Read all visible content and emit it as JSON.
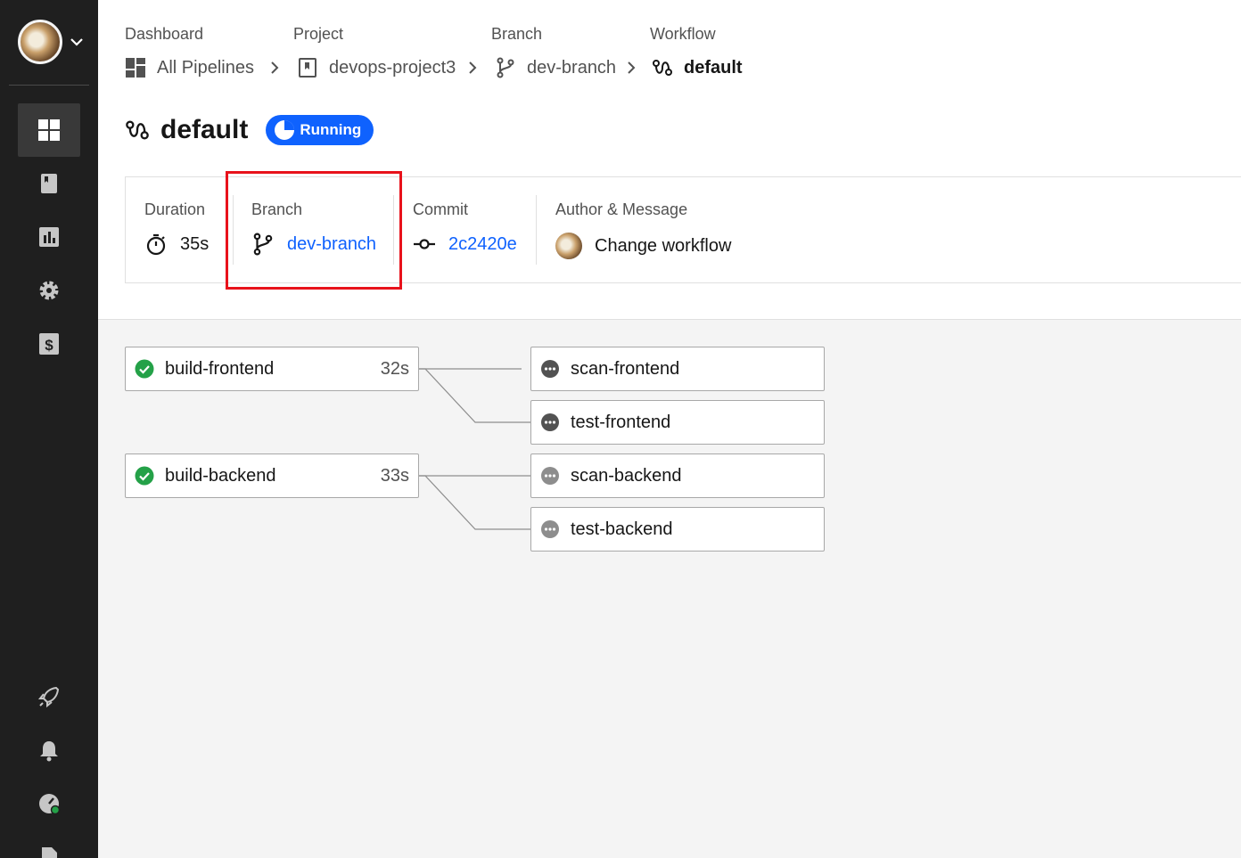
{
  "sidebar": {
    "nav": [
      "dashboard-icon",
      "project-icon",
      "insights-icon",
      "settings-icon",
      "billing-icon",
      "rocket-icon",
      "bell-icon",
      "status-icon",
      "docs-icon"
    ]
  },
  "breadcrumb": {
    "dashboard": {
      "label": "Dashboard",
      "value": "All Pipelines"
    },
    "project": {
      "label": "Project",
      "value": "devops-project3"
    },
    "branch": {
      "label": "Branch",
      "value": "dev-branch"
    },
    "workflow": {
      "label": "Workflow",
      "value": "default"
    }
  },
  "header": {
    "title": "default",
    "status": "Running"
  },
  "summary": {
    "duration": {
      "label": "Duration",
      "value": "35s"
    },
    "branch": {
      "label": "Branch",
      "value": "dev-branch"
    },
    "commit": {
      "label": "Commit",
      "value": "2c2420e"
    },
    "author": {
      "label": "Author & Message",
      "message": "Change workflow"
    }
  },
  "jobs": {
    "build_frontend": {
      "name": "build-frontend",
      "duration": "32s",
      "status": "success"
    },
    "build_backend": {
      "name": "build-backend",
      "duration": "33s",
      "status": "success"
    },
    "scan_frontend": {
      "name": "scan-frontend",
      "status": "pending"
    },
    "test_frontend": {
      "name": "test-frontend",
      "status": "pending"
    },
    "scan_backend": {
      "name": "scan-backend",
      "status": "pending"
    },
    "test_backend": {
      "name": "test-backend",
      "status": "pending"
    }
  },
  "colors": {
    "accent": "#0f62fe",
    "success": "#24a148",
    "highlight": "#e8121b",
    "sidebar": "#1f1f1f"
  }
}
